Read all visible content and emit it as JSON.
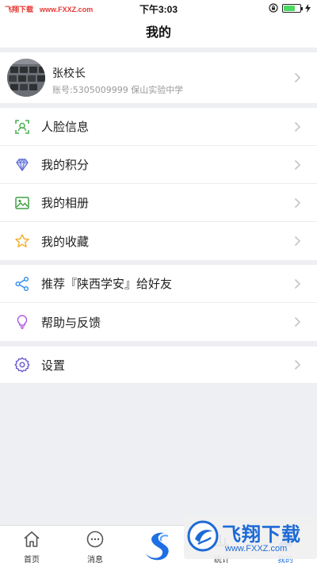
{
  "status_bar": {
    "watermark_name": "飞翔下载",
    "watermark_url": "www.FXXZ.com",
    "time": "下午3:03"
  },
  "header": {
    "title": "我的"
  },
  "profile": {
    "name": "张校长",
    "account": "账号:5305009999 保山实验中学"
  },
  "menu_group_1": [
    {
      "label": "人脸信息",
      "icon": "face-scan-icon"
    },
    {
      "label": "我的积分",
      "icon": "diamond-icon"
    },
    {
      "label": "我的相册",
      "icon": "photo-album-icon"
    },
    {
      "label": "我的收藏",
      "icon": "star-icon"
    }
  ],
  "menu_group_2": [
    {
      "label": "推荐『陕西学安』给好友",
      "icon": "share-icon"
    },
    {
      "label": "帮助与反馈",
      "icon": "lightbulb-icon"
    }
  ],
  "menu_group_3": [
    {
      "label": "设置",
      "icon": "gear-icon"
    }
  ],
  "tabbar": {
    "tabs": [
      {
        "label": "首页",
        "icon": "home-icon"
      },
      {
        "label": "消息",
        "icon": "message-icon"
      },
      {
        "label": "统计",
        "icon": "chart-icon"
      },
      {
        "label": "我的",
        "icon": "person-icon"
      }
    ],
    "active": "我的"
  },
  "watermark_badge": {
    "title": "飞翔下载",
    "url": "www.FXXZ.com"
  },
  "colors": {
    "accent": "#1e6fe6",
    "face_icon": "#4caf50",
    "diamond_icon": "#5b6fd6",
    "album_icon": "#43a047",
    "star_icon": "#f2b233",
    "share_icon": "#2d8cf0",
    "bulb_icon": "#b05be0",
    "gear_icon": "#6a5acd"
  }
}
